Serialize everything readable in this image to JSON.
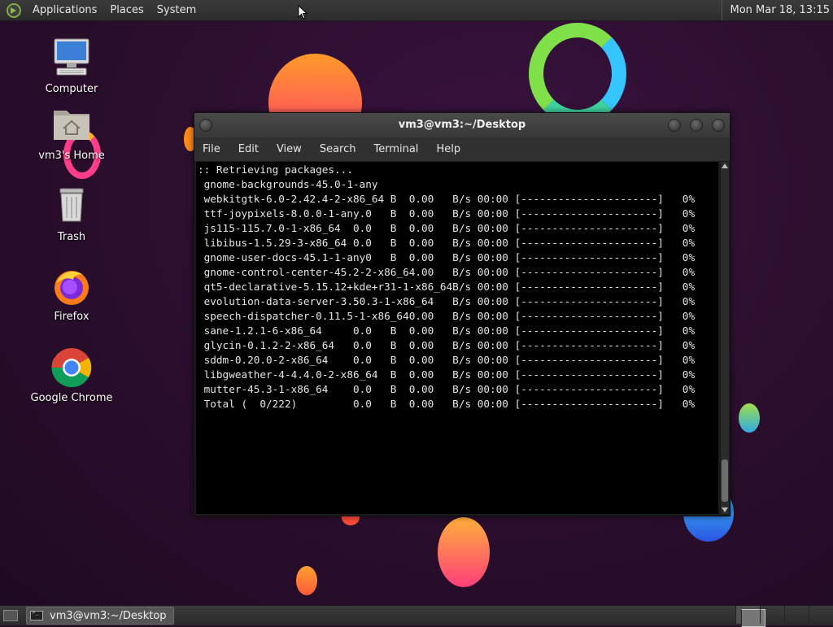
{
  "top_panel": {
    "menus": [
      "Applications",
      "Places",
      "System"
    ],
    "clock": "Mon Mar 18, 13:15"
  },
  "desktop_icons": [
    {
      "label": "Computer",
      "icon": "computer-icon"
    },
    {
      "label": "vm3's Home",
      "icon": "home-folder-icon"
    },
    {
      "label": "Trash",
      "icon": "trash-icon"
    },
    {
      "label": "Firefox",
      "icon": "firefox-icon"
    },
    {
      "label": "Google Chrome",
      "icon": "chrome-icon"
    }
  ],
  "terminal": {
    "title": "vm3@vm3:~/Desktop",
    "menus": [
      "File",
      "Edit",
      "View",
      "Search",
      "Terminal",
      "Help"
    ],
    "lines": [
      ":: Retrieving packages...",
      " gnome-backgrounds-45.0-1-any",
      " webkitgtk-6.0-2.42.4-2-x86_64 B  0.00   B/s 00:00 [----------------------]   0%",
      " ttf-joypixels-8.0.0-1-any.0   B  0.00   B/s 00:00 [----------------------]   0%",
      " js115-115.7.0-1-x86_64  0.0   B  0.00   B/s 00:00 [----------------------]   0%",
      " libibus-1.5.29-3-x86_64 0.0   B  0.00   B/s 00:00 [----------------------]   0%",
      " gnome-user-docs-45.1-1-any0   B  0.00   B/s 00:00 [----------------------]   0%",
      " gnome-control-center-45.2-2-x86_64.00   B/s 00:00 [----------------------]   0%",
      " qt5-declarative-5.15.12+kde+r31-1-x86_64B/s 00:00 [----------------------]   0%",
      " evolution-data-server-3.50.3-1-x86_64   B/s 00:00 [----------------------]   0%",
      " speech-dispatcher-0.11.5-1-x86_640.00   B/s 00:00 [----------------------]   0%",
      " sane-1.2.1-6-x86_64     0.0   B  0.00   B/s 00:00 [----------------------]   0%",
      " glycin-0.1.2-2-x86_64   0.0   B  0.00   B/s 00:00 [----------------------]   0%",
      " sddm-0.20.0-2-x86_64    0.0   B  0.00   B/s 00:00 [----------------------]   0%",
      " libgweather-4-4.4.0-2-x86_64  B  0.00   B/s 00:00 [----------------------]   0%",
      " mutter-45.3-1-x86_64    0.0   B  0.00   B/s 00:00 [----------------------]   0%",
      " Total (  0/222)         0.0   B  0.00   B/s 00:00 [----------------------]   0%"
    ]
  },
  "taskbar": {
    "window_button": "vm3@vm3:~/Desktop"
  }
}
